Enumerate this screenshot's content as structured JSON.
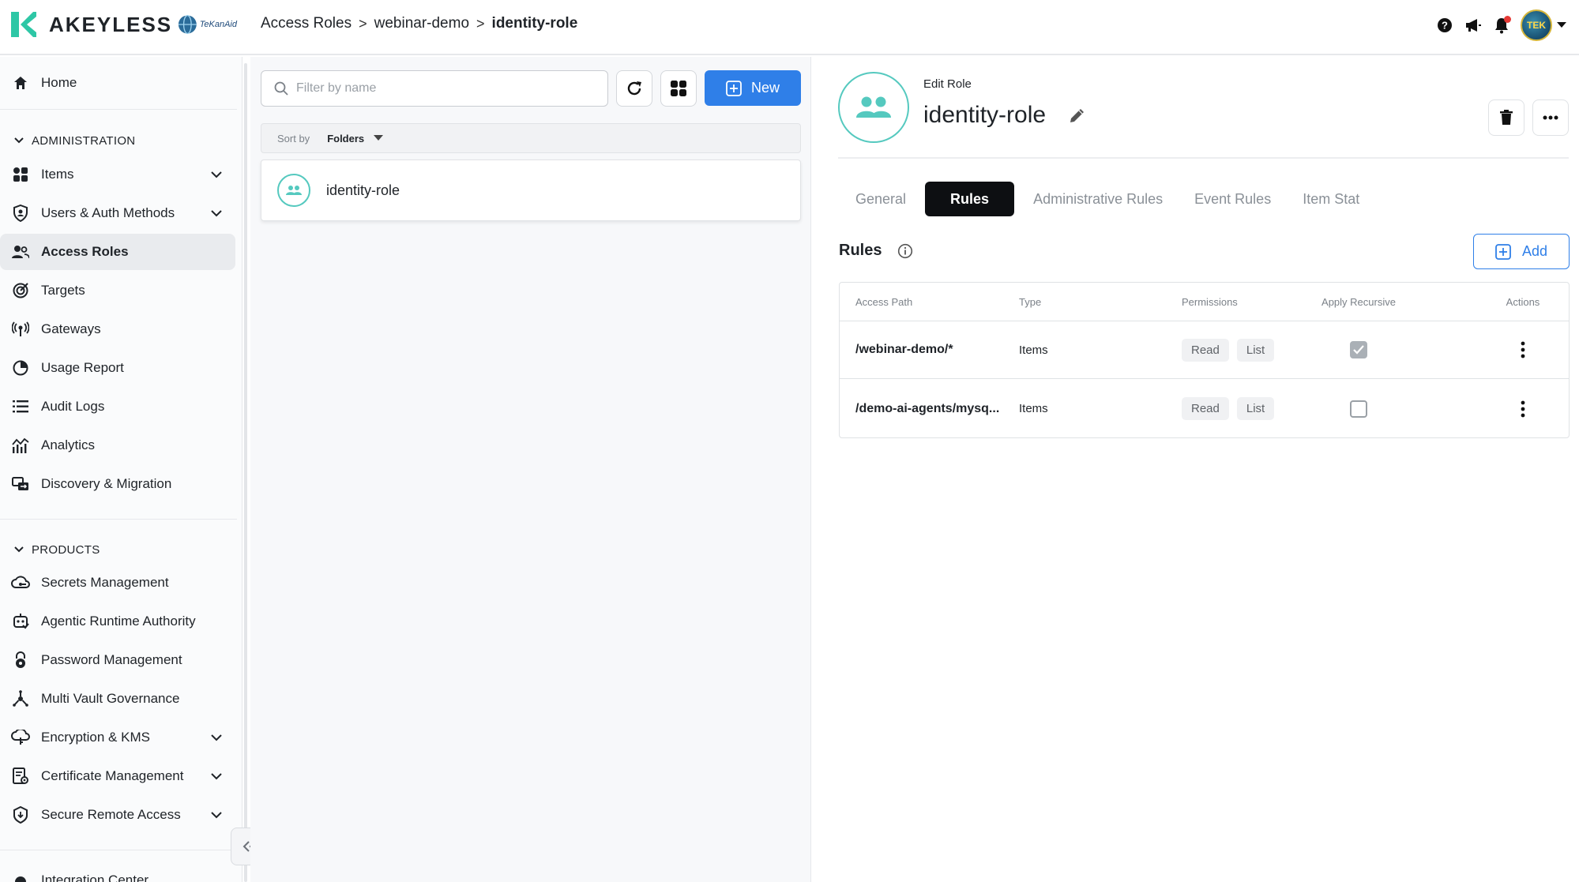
{
  "app": {
    "brand": "AKEYLESS",
    "partner_logo_text": "TeKanAid",
    "colors": {
      "accent": "#2f7fe8",
      "teal": "#55c9bf",
      "active_tab": "#0d0f12",
      "logo_green": "#2ec7a6"
    }
  },
  "breadcrumb": [
    {
      "label": "Access Roles"
    },
    {
      "label": "webinar-demo"
    },
    {
      "label": "identity-role"
    }
  ],
  "topbar": {
    "icons": [
      "help-icon",
      "megaphone-icon",
      "bell-icon"
    ],
    "avatar_text": "TEK"
  },
  "sidebar": {
    "home": "Home",
    "admin_section": "ADMINISTRATION",
    "admin_items": [
      {
        "label": "Items",
        "icon": "items-icon",
        "expandable": true
      },
      {
        "label": "Users & Auth Methods",
        "icon": "shield-user-icon",
        "expandable": true
      },
      {
        "label": "Access Roles",
        "icon": "users-icon",
        "active": true
      },
      {
        "label": "Targets",
        "icon": "target-icon"
      },
      {
        "label": "Gateways",
        "icon": "gateway-icon"
      },
      {
        "label": "Usage Report",
        "icon": "pie-chart-icon"
      },
      {
        "label": "Audit Logs",
        "icon": "list-icon"
      },
      {
        "label": "Analytics",
        "icon": "analytics-icon"
      },
      {
        "label": "Discovery & Migration",
        "icon": "migration-icon"
      }
    ],
    "products_section": "PRODUCTS",
    "product_items": [
      {
        "label": "Secrets Management",
        "icon": "secrets-icon"
      },
      {
        "label": "Agentic Runtime Authority",
        "icon": "agent-icon"
      },
      {
        "label": "Password Management",
        "icon": "password-icon"
      },
      {
        "label": "Multi Vault Governance",
        "icon": "vault-icon"
      },
      {
        "label": "Encryption & KMS",
        "icon": "cloud-key-icon",
        "expandable": true
      },
      {
        "label": "Certificate Management",
        "icon": "certificate-icon",
        "expandable": true
      },
      {
        "label": "Secure Remote Access",
        "icon": "remote-access-icon",
        "expandable": true
      }
    ],
    "integration": "Integration Center"
  },
  "list_panel": {
    "filter_placeholder": "Filter by name",
    "new_label": "New",
    "sort_label": "Sort by",
    "sort_value": "Folders",
    "items": [
      {
        "name": "identity-role"
      }
    ]
  },
  "detail": {
    "edit_label": "Edit Role",
    "role_name": "identity-role",
    "tabs": [
      "General",
      "Rules",
      "Administrative Rules",
      "Event Rules",
      "Item Stat"
    ],
    "active_tab": "Rules",
    "rules_title": "Rules",
    "add_label": "Add",
    "table": {
      "headers": [
        "Access Path",
        "Type",
        "Permissions",
        "Apply Recursive",
        "Actions"
      ],
      "rows": [
        {
          "path": "/webinar-demo/*",
          "type": "Items",
          "permissions": [
            "Read",
            "List"
          ],
          "recursive": true
        },
        {
          "path": "/demo-ai-agents/mysq...",
          "type": "Items",
          "permissions": [
            "Read",
            "List"
          ],
          "recursive": false
        }
      ]
    }
  }
}
